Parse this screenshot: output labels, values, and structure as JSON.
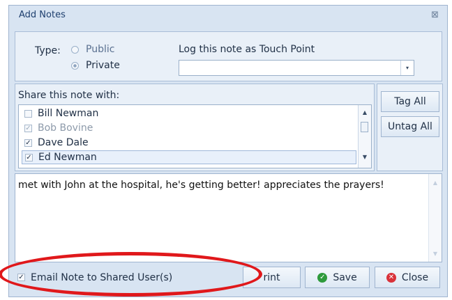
{
  "window": {
    "title": "Add Notes",
    "close_glyph": "⊠"
  },
  "type_section": {
    "label": "Type:",
    "options": [
      {
        "label": "Public",
        "selected": false
      },
      {
        "label": "Private",
        "selected": true
      }
    ]
  },
  "touch_point": {
    "label": "Log this note as Touch Point",
    "value": "",
    "arrow": "▾"
  },
  "share": {
    "title": "Share this note with:",
    "users": [
      {
        "name": "Bill Newman",
        "checked": false,
        "mark": "",
        "enabled": true
      },
      {
        "name": "Bob Bovine",
        "checked": true,
        "mark": "✓",
        "enabled": false
      },
      {
        "name": "Dave Dale",
        "checked": true,
        "mark": "✓",
        "enabled": true
      },
      {
        "name": "Ed Newman",
        "checked": true,
        "mark": "✓",
        "enabled": true,
        "selected": true
      }
    ],
    "scroll": {
      "up": "▲",
      "down": "▼"
    }
  },
  "tag_buttons": {
    "tag_all": "Tag All",
    "untag_all": "Untag All"
  },
  "note_text": "met with John at the hospital, he's getting better! appreciates the prayers!",
  "footer": {
    "email_label": "Email Note to Shared User(s)",
    "email_mark": "✓",
    "print_label": "rint",
    "save_label": "Save",
    "close_label": "Close",
    "save_icon": "✓",
    "close_icon": "✕"
  },
  "colors": {
    "annotation_oval": "#e0181b",
    "save_icon": "#2e9a3c",
    "close_icon": "#d9323a"
  }
}
